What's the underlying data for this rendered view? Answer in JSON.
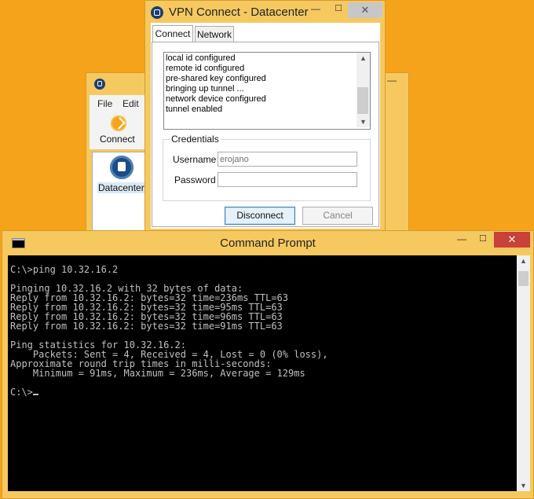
{
  "client_window": {
    "menu": {
      "file": "File",
      "edit": "Edit"
    },
    "toolbar": {
      "connect_label": "Connect"
    },
    "connections": [
      {
        "label": "Datacenter"
      }
    ],
    "icons": {
      "app": "vpn-shield-icon",
      "connect": "connect-icon",
      "connection": "shield-lock-icon"
    }
  },
  "vpn_window": {
    "title": "VPN Connect - Datacenter",
    "tabs": [
      {
        "label": "Connect"
      },
      {
        "label": "Network"
      }
    ],
    "active_tab": "Connect",
    "log_lines": [
      "local id configured",
      "remote id configured",
      "pre-shared key configured",
      "bringing up tunnel ...",
      "network device configured",
      "tunnel enabled"
    ],
    "credentials": {
      "legend": "Credentials",
      "username_label": "Username",
      "username_value": "erojano",
      "password_label": "Password",
      "password_value": ""
    },
    "buttons": {
      "disconnect": "Disconnect",
      "cancel": "Cancel"
    }
  },
  "cmd_window": {
    "title": "Command Prompt",
    "console_text": "C:\\>ping 10.32.16.2\n\nPinging 10.32.16.2 with 32 bytes of data:\nReply from 10.32.16.2: bytes=32 time=236ms TTL=63\nReply from 10.32.16.2: bytes=32 time=95ms TTL=63\nReply from 10.32.16.2: bytes=32 time=96ms TTL=63\nReply from 10.32.16.2: bytes=32 time=91ms TTL=63\n\nPing statistics for 10.32.16.2:\n    Packets: Sent = 4, Received = 4, Lost = 0 (0% loss),\nApproximate round trip times in milli-seconds:\n    Minimum = 91ms, Maximum = 236ms, Average = 129ms\n\nC:\\>"
  },
  "colors": {
    "desktop": "#f5a31a",
    "window_frame": "#f5c95f",
    "console_bg": "#000000",
    "console_fg": "#c0c0c0",
    "close_button_active": "#c8423a"
  }
}
